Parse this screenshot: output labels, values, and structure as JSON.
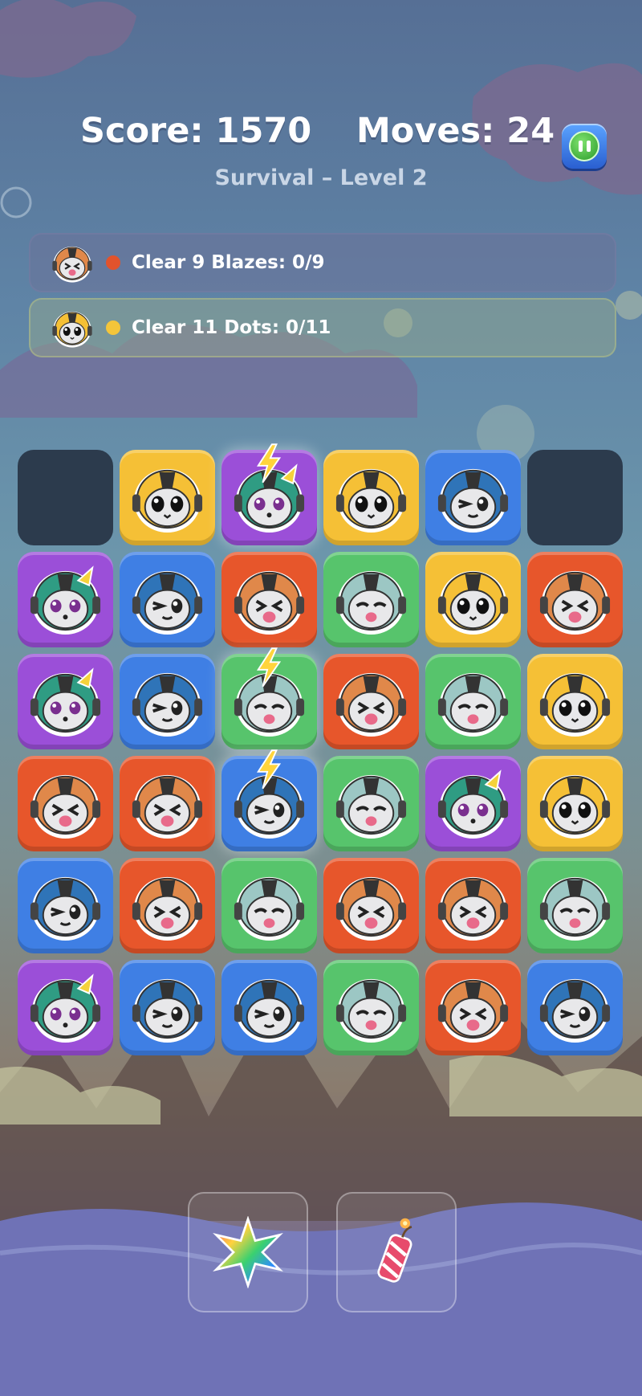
{
  "hud": {
    "score_text": "Score: 1570",
    "moves_text": "Moves: 24",
    "mode_text": "Survival – Level 2"
  },
  "pause_button": {
    "icon": "pause-icon"
  },
  "goals": [
    {
      "text": "Clear 9 Blazes: 0/9",
      "piece": "orange",
      "dot_color": "#e2532c"
    },
    {
      "text": "Clear 11 Dots: 0/11",
      "piece": "yellow",
      "dot_color": "#f4c53a"
    }
  ],
  "board": {
    "rows": 6,
    "cols": 6,
    "grid": [
      [
        "empty",
        "yellow",
        "purple",
        "yellow",
        "blue",
        "empty"
      ],
      [
        "purple",
        "blue",
        "orange",
        "green",
        "yellow",
        "orange"
      ],
      [
        "purple",
        "blue",
        "green",
        "orange",
        "green",
        "yellow"
      ],
      [
        "orange",
        "orange",
        "blue",
        "green",
        "purple",
        "yellow"
      ],
      [
        "blue",
        "orange",
        "green",
        "orange",
        "orange",
        "green"
      ],
      [
        "purple",
        "blue",
        "blue",
        "green",
        "orange",
        "blue"
      ]
    ],
    "special": [
      [
        0,
        2
      ],
      [
        2,
        2
      ],
      [
        3,
        2
      ]
    ]
  },
  "piece_colors": {
    "yellow": "#f5c036",
    "purple": "#9b4fd8",
    "blue": "#3f7fe4",
    "orange": "#e7562b",
    "green": "#57c46c"
  },
  "boosters": [
    {
      "name": "rainbow-star",
      "icon": "rainbow-star-icon"
    },
    {
      "name": "firecracker",
      "icon": "firecracker-icon"
    }
  ]
}
